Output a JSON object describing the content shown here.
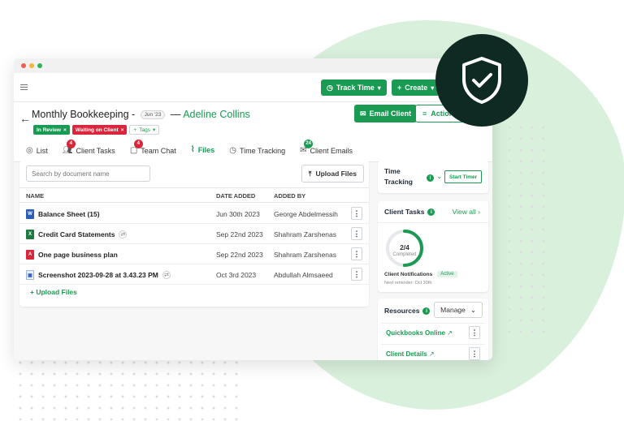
{
  "topbar": {
    "track_time": "Track Time",
    "create": "Create"
  },
  "header": {
    "title": "Monthly Bookkeeping -",
    "date_pill": "Jun '23",
    "dash": "—",
    "client_name": "Adeline Collins",
    "tags": [
      "In Review",
      "Waiting on Client"
    ],
    "tags_button": "Tags",
    "email_client": "Email Client",
    "actions": "Actions"
  },
  "tabs": [
    {
      "label": "List"
    },
    {
      "label": "Client Tasks",
      "badge": "4"
    },
    {
      "label": "Team Chat",
      "badge": "4"
    },
    {
      "label": "Files"
    },
    {
      "label": "Time Tracking"
    },
    {
      "label": "Client Emails",
      "badge": "24"
    }
  ],
  "files": {
    "search_placeholder": "Search by document name",
    "upload_button": "Upload Files",
    "columns": {
      "name": "NAME",
      "date_added": "DATE ADDED",
      "added_by": "ADDED BY"
    },
    "rows": [
      {
        "name": "Balance Sheet (15)",
        "date": "Jun 30th 2023",
        "by": "George Abdelmessih",
        "icon": "word-file-icon"
      },
      {
        "name": "Credit Card Statements",
        "date": "Sep 22nd 2023",
        "by": "Shahram Zarshenas",
        "icon": "excel-file-icon"
      },
      {
        "name": "One page business plan",
        "date": "Sep 22nd 2023",
        "by": "Shahram Zarshenas",
        "icon": "pdf-file-icon"
      },
      {
        "name": "Screenshot 2023-09-28 at 3.43.23 PM",
        "date": "Oct 3rd 2023",
        "by": "Abdullah Almsaeed",
        "icon": "image-file-icon"
      }
    ],
    "upload_link": "Upload Files"
  },
  "time_tracking": {
    "label": "Time Tracking",
    "start_timer": "Start Timer"
  },
  "client_tasks": {
    "heading": "Client Tasks",
    "view_all": "View all",
    "progress_text": "2/4",
    "progress_fraction": 0.5,
    "progress_label": "Completed",
    "notifications_label": "Client Notifications",
    "status": "Active",
    "reminder": "Next reminder: Oct 30th"
  },
  "resources": {
    "heading": "Resources",
    "manage": "Manage",
    "items": [
      "Quickbooks Online",
      "Client Details"
    ]
  },
  "colors": {
    "brand_green": "#1a9a52",
    "tag_red": "#d9263c",
    "shield_bg": "#0f2a23",
    "blob": "#d9f0dc"
  }
}
